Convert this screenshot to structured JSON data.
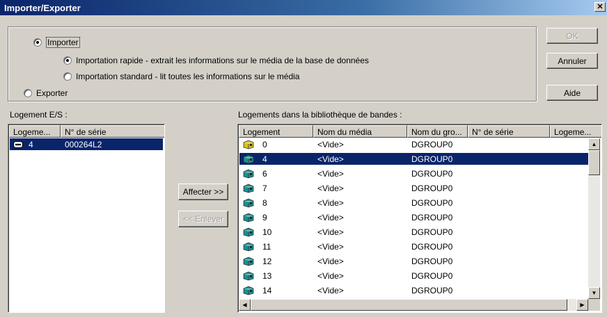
{
  "window": {
    "title": "Importer/Exporter",
    "close_glyph": "✕"
  },
  "mode": {
    "import_label": "Importer",
    "quick_import_label": "Importation rapide - extrait les informations sur le média de la base de données",
    "standard_import_label": "Importation standard - lit toutes les informations sur le média",
    "export_label": "Exporter",
    "selected": "import",
    "import_type_selected": "quick"
  },
  "buttons": {
    "ok": "OK",
    "cancel": "Annuler",
    "help": "Aide",
    "assign": "Affecter >>",
    "remove": "<< Enlever"
  },
  "io_slots": {
    "label": "Logement E/S :",
    "columns": [
      "Logeme...",
      "N° de série"
    ],
    "rows": [
      {
        "slot": "4",
        "serial": "000264L2",
        "selected": true
      }
    ]
  },
  "library_slots": {
    "label": "Logements dans la bibliothèque de bandes :",
    "columns": [
      "Logement",
      "Nom du média",
      "Nom du gro...",
      "N° de série",
      "Logeme..."
    ],
    "rows": [
      {
        "slot": "0",
        "media": "<Vide>",
        "group": "DGROUP0",
        "serial": "",
        "icon": "tape-yellow-icon"
      },
      {
        "slot": "4",
        "media": "<Vide>",
        "group": "DGROUP0",
        "serial": "",
        "icon": "tape-teal-icon",
        "selected": true
      },
      {
        "slot": "6",
        "media": "<Vide>",
        "group": "DGROUP0",
        "serial": "",
        "icon": "tape-teal-icon"
      },
      {
        "slot": "7",
        "media": "<Vide>",
        "group": "DGROUP0",
        "serial": "",
        "icon": "tape-teal-icon"
      },
      {
        "slot": "8",
        "media": "<Vide>",
        "group": "DGROUP0",
        "serial": "",
        "icon": "tape-teal-icon"
      },
      {
        "slot": "9",
        "media": "<Vide>",
        "group": "DGROUP0",
        "serial": "",
        "icon": "tape-teal-icon"
      },
      {
        "slot": "10",
        "media": "<Vide>",
        "group": "DGROUP0",
        "serial": "",
        "icon": "tape-teal-icon"
      },
      {
        "slot": "11",
        "media": "<Vide>",
        "group": "DGROUP0",
        "serial": "",
        "icon": "tape-teal-icon"
      },
      {
        "slot": "12",
        "media": "<Vide>",
        "group": "DGROUP0",
        "serial": "",
        "icon": "tape-teal-icon"
      },
      {
        "slot": "13",
        "media": "<Vide>",
        "group": "DGROUP0",
        "serial": "",
        "icon": "tape-teal-icon"
      },
      {
        "slot": "14",
        "media": "<Vide>",
        "group": "DGROUP0",
        "serial": "",
        "icon": "tape-teal-icon"
      }
    ]
  },
  "colors": {
    "selection": "#0a246a",
    "tape_yellow": "#d8c21a",
    "tape_teal": "#1a8f8f"
  }
}
